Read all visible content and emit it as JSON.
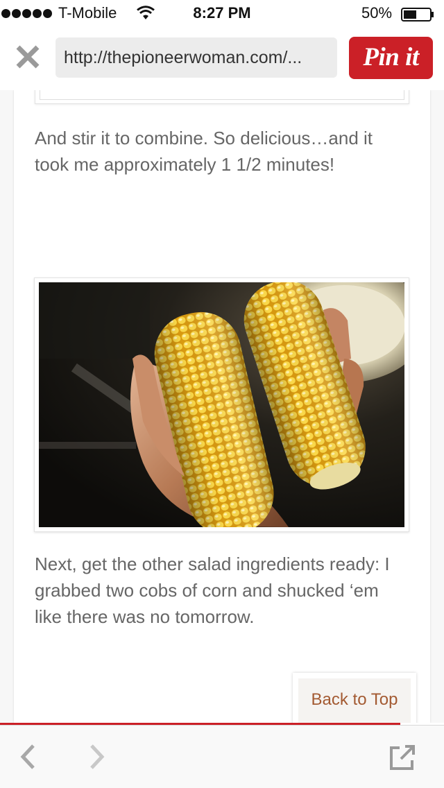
{
  "status_bar": {
    "carrier": "T-Mobile",
    "time": "8:27 PM",
    "battery_percent": "50%",
    "battery_level": 0.5,
    "signal_bars": 5
  },
  "browser": {
    "url": "http://thepioneerwoman.com/...",
    "pin_label": "Pin it",
    "pin_color": "#cb2027"
  },
  "article": {
    "paragraph_1": "And stir it to combine. So delicious…and it took me approximately 1 1/2 minutes!",
    "paragraph_2": "Next, get the other salad ingredients ready: I grabbed two cobs of corn and shucked ‘em like there was no tomorrow.",
    "photo_subject": "hand-holding-two-shucked-corn-cobs"
  },
  "back_to_top_label": "Back to Top",
  "toolbar": {
    "icons": [
      "chevron-left-icon",
      "chevron-right-icon",
      "share-icon"
    ]
  },
  "colors": {
    "accent": "#cb2027",
    "link": "#a35a32",
    "body_text": "#666666"
  }
}
